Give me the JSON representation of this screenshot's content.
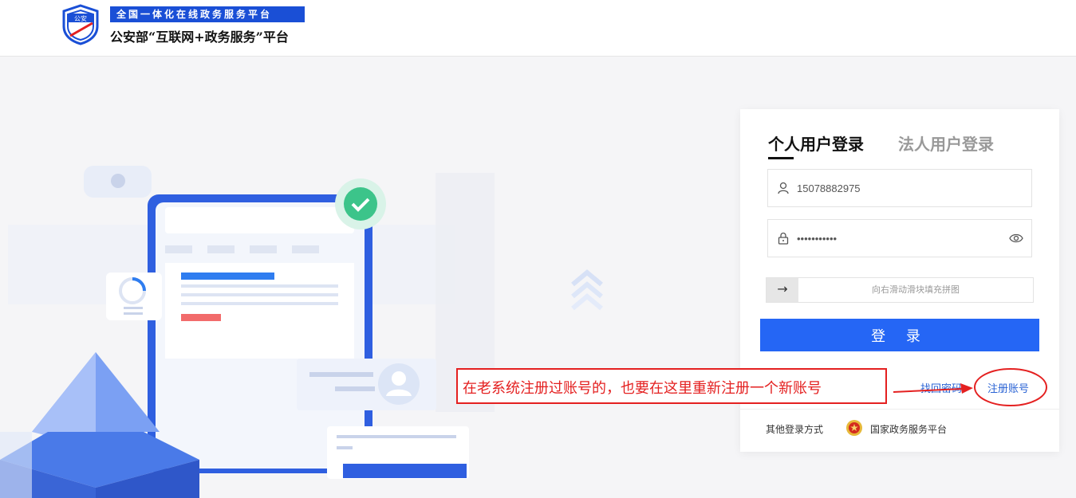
{
  "header": {
    "logo_text": "公安",
    "banner": "全国一体化在线政务服务平台",
    "title": "公安部“互联网+政务服务”平台"
  },
  "login": {
    "tabs": [
      {
        "label": "个人用户登录",
        "active": true
      },
      {
        "label": "法人用户登录",
        "active": false
      }
    ],
    "username_value": "15078882975",
    "password_value": "•••••••••••",
    "slider_arrow": "→",
    "slider_text": "向右滑动滑块填充拼图",
    "submit_label": "登 录",
    "forgot_label": "找回密码",
    "register_label": "注册账号",
    "other_label": "其他登录方式",
    "gov_platform_label": "国家政务服务平台"
  },
  "annotation": {
    "text": "在老系统注册过账号的，也要在这里重新注册一个新账号"
  },
  "colors": {
    "accent": "#2566f5",
    "banner": "#1a4fd6",
    "annotation": "#e42020",
    "link": "#2a63d4"
  }
}
